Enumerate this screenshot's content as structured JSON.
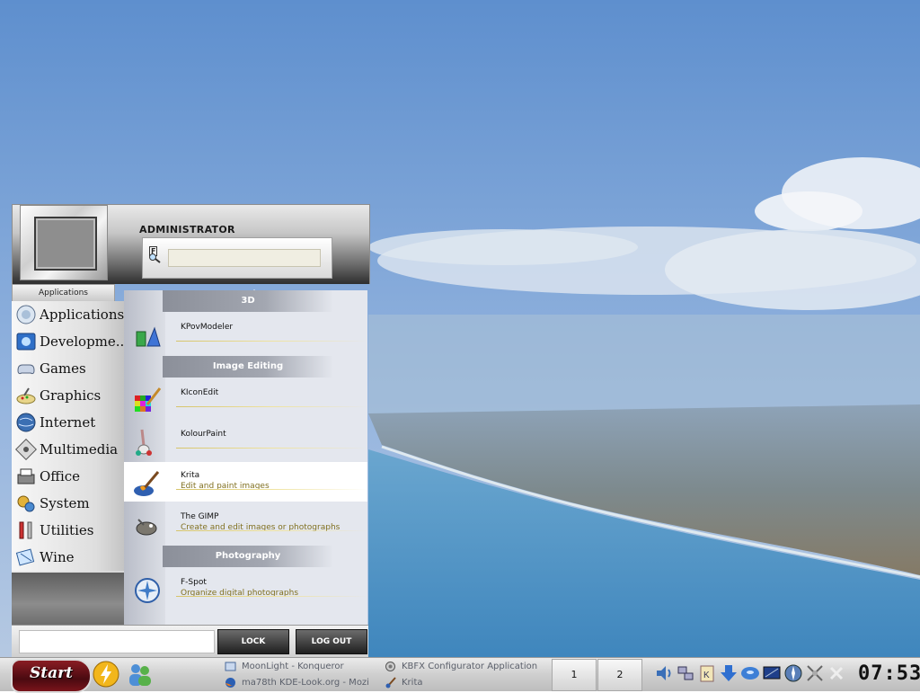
{
  "menu": {
    "user_name": "ADMINISTRATOR",
    "search_icon": "F",
    "search_placeholder": "",
    "category_tab": "Applications",
    "categories": [
      {
        "label": "Applications",
        "icon": "applications-icon"
      },
      {
        "label": "Developme...",
        "icon": "development-icon"
      },
      {
        "label": "Games",
        "icon": "games-icon"
      },
      {
        "label": "Graphics",
        "icon": "graphics-icon"
      },
      {
        "label": "Internet",
        "icon": "internet-icon"
      },
      {
        "label": "Multimedia",
        "icon": "multimedia-icon"
      },
      {
        "label": "Office",
        "icon": "office-icon"
      },
      {
        "label": "System",
        "icon": "system-icon"
      },
      {
        "label": "Utilities",
        "icon": "utilities-icon"
      },
      {
        "label": "Wine",
        "icon": "wine-icon"
      }
    ],
    "sections": [
      {
        "title": "3D",
        "apps": [
          {
            "name": "KPovModeler",
            "description": "",
            "icon": "kpovmodeler-icon",
            "selected": false
          }
        ]
      },
      {
        "title": "Image Editing",
        "apps": [
          {
            "name": "KIconEdit",
            "description": "",
            "icon": "kiconedit-icon",
            "selected": false
          },
          {
            "name": "KolourPaint",
            "description": "",
            "icon": "kolourpaint-icon",
            "selected": false
          },
          {
            "name": "Krita",
            "description": "Edit and paint images",
            "icon": "krita-icon",
            "selected": true
          },
          {
            "name": "The GIMP",
            "description": "Create and edit images or photographs",
            "icon": "gimp-icon",
            "selected": false
          }
        ]
      },
      {
        "title": "Photography",
        "apps": [
          {
            "name": "F-Spot",
            "description": "Organize digital photographs",
            "icon": "fspot-icon",
            "selected": false
          }
        ]
      }
    ],
    "lock_label": "LOCK",
    "logout_label": "LOG OUT"
  },
  "taskbar": {
    "start_label": "Start",
    "tasks": [
      {
        "label": "MoonLight - Konqueror",
        "icon": "konqueror-icon"
      },
      {
        "label": "ma78th KDE-Look.org - Mozi",
        "icon": "firefox-icon"
      },
      {
        "label": "KBFX Configurator Application",
        "icon": "kbfx-icon"
      },
      {
        "label": "Krita",
        "icon": "krita-icon"
      }
    ],
    "desktops": [
      "1",
      "2"
    ],
    "tray_icons": [
      "speaker-icon",
      "network-icon",
      "klipper-icon",
      "download-icon",
      "disc-icon",
      "monitor-icon",
      "compass-icon",
      "settings-icon",
      "close-icon"
    ],
    "clock": "07:53"
  },
  "colors": {
    "start_button": "#6b1118",
    "selected_app_bg": "#ffffff",
    "description_text": "#807020",
    "sky": "#6f9ed8",
    "sea": "#4f93c4"
  }
}
